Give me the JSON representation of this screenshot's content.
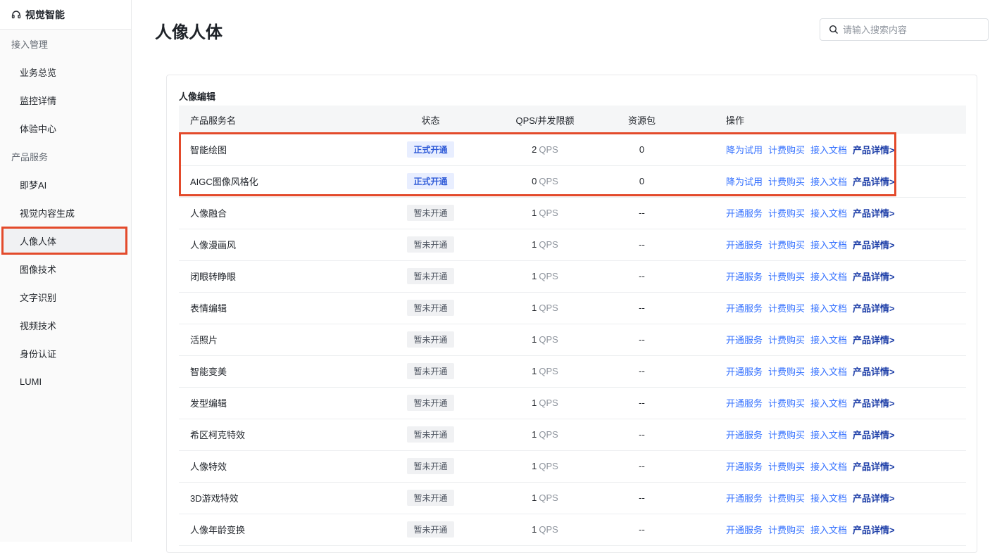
{
  "sidebar": {
    "brand": "视觉智能",
    "groups": [
      {
        "label": "接入管理",
        "items": [
          "业务总览",
          "监控详情",
          "体验中心"
        ]
      },
      {
        "label": "产品服务",
        "items": [
          "即梦AI",
          "视觉内容生成",
          "人像人体",
          "图像技术",
          "文字识别",
          "视频技术",
          "身份认证",
          "LUMI"
        ]
      }
    ],
    "active": "人像人体"
  },
  "header": {
    "title": "人像人体",
    "search_placeholder": "请输入搜索内容"
  },
  "section": {
    "title": "人像编辑",
    "columns": [
      "产品服务名",
      "状态",
      "QPS/并发限额",
      "资源包",
      "操作"
    ],
    "rows": [
      {
        "name": "智能绘图",
        "status": "正式开通",
        "active": true,
        "qps": "2",
        "unit": "QPS",
        "pkg": "0",
        "ops": [
          "降为试用",
          "计费购买",
          "接入文档",
          "产品详情>"
        ]
      },
      {
        "name": "AIGC图像风格化",
        "status": "正式开通",
        "active": true,
        "qps": "0",
        "unit": "QPS",
        "pkg": "0",
        "ops": [
          "降为试用",
          "计费购买",
          "接入文档",
          "产品详情>"
        ]
      },
      {
        "name": "人像融合",
        "status": "暂未开通",
        "active": false,
        "qps": "1",
        "unit": "QPS",
        "pkg": "--",
        "ops": [
          "开通服务",
          "计费购买",
          "接入文档",
          "产品详情>"
        ]
      },
      {
        "name": "人像漫画风",
        "status": "暂未开通",
        "active": false,
        "qps": "1",
        "unit": "QPS",
        "pkg": "--",
        "ops": [
          "开通服务",
          "计费购买",
          "接入文档",
          "产品详情>"
        ]
      },
      {
        "name": "闭眼转睁眼",
        "status": "暂未开通",
        "active": false,
        "qps": "1",
        "unit": "QPS",
        "pkg": "--",
        "ops": [
          "开通服务",
          "计费购买",
          "接入文档",
          "产品详情>"
        ]
      },
      {
        "name": "表情编辑",
        "status": "暂未开通",
        "active": false,
        "qps": "1",
        "unit": "QPS",
        "pkg": "--",
        "ops": [
          "开通服务",
          "计费购买",
          "接入文档",
          "产品详情>"
        ]
      },
      {
        "name": "活照片",
        "status": "暂未开通",
        "active": false,
        "qps": "1",
        "unit": "QPS",
        "pkg": "--",
        "ops": [
          "开通服务",
          "计费购买",
          "接入文档",
          "产品详情>"
        ]
      },
      {
        "name": "智能变美",
        "status": "暂未开通",
        "active": false,
        "qps": "1",
        "unit": "QPS",
        "pkg": "--",
        "ops": [
          "开通服务",
          "计费购买",
          "接入文档",
          "产品详情>"
        ]
      },
      {
        "name": "发型编辑",
        "status": "暂未开通",
        "active": false,
        "qps": "1",
        "unit": "QPS",
        "pkg": "--",
        "ops": [
          "开通服务",
          "计费购买",
          "接入文档",
          "产品详情>"
        ]
      },
      {
        "name": "希区柯克特效",
        "status": "暂未开通",
        "active": false,
        "qps": "1",
        "unit": "QPS",
        "pkg": "--",
        "ops": [
          "开通服务",
          "计费购买",
          "接入文档",
          "产品详情>"
        ]
      },
      {
        "name": "人像特效",
        "status": "暂未开通",
        "active": false,
        "qps": "1",
        "unit": "QPS",
        "pkg": "--",
        "ops": [
          "开通服务",
          "计费购买",
          "接入文档",
          "产品详情>"
        ]
      },
      {
        "name": "3D游戏特效",
        "status": "暂未开通",
        "active": false,
        "qps": "1",
        "unit": "QPS",
        "pkg": "--",
        "ops": [
          "开通服务",
          "计费购买",
          "接入文档",
          "产品详情>"
        ]
      },
      {
        "name": "人像年龄变换",
        "status": "暂未开通",
        "active": false,
        "qps": "1",
        "unit": "QPS",
        "pkg": "--",
        "ops": [
          "开通服务",
          "计费购买",
          "接入文档",
          "产品详情>"
        ]
      }
    ]
  },
  "colors": {
    "accent": "#3370ff",
    "highlight": "#e34a2b",
    "badge_on": "#2f5bd8"
  },
  "icons": {
    "brand": "headset-icon",
    "search": "search-icon"
  }
}
